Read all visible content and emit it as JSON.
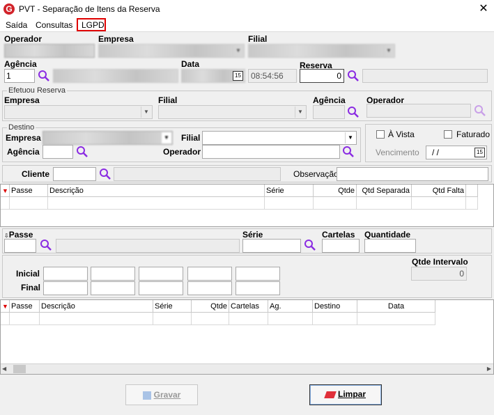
{
  "window": {
    "title": "PVT - Separação de Itens da Reserva",
    "close": "✕",
    "logo": "G"
  },
  "menu": {
    "saida": "Saída",
    "consultas": "Consultas",
    "lgpd": "LGPD"
  },
  "labels": {
    "operador": "Operador",
    "empresa": "Empresa",
    "filial": "Filial",
    "agencia": "Agência",
    "data": "Data",
    "reserva": "Reserva",
    "efetuou_reserva": "Efetuou Reserva",
    "destino": "Destino",
    "a_vista": "À Vista",
    "faturado": "Faturado",
    "vencimento": "Vencimento",
    "cliente": "Cliente",
    "observacao": "Observação",
    "passe": "Passe",
    "serie": "Série",
    "cartelas": "Cartelas",
    "quantidade": "Quantidade",
    "inicial": "Inicial",
    "final": "Final",
    "qtde_intervalo": "Qtde Intervalo"
  },
  "values": {
    "agencia": "1",
    "hora": "08:54:56",
    "vencimento": "/ /",
    "qtde_intervalo": "0",
    "reserva": "0"
  },
  "grid1": {
    "columns": [
      "Passe",
      "Descrição",
      "Série",
      "Qtde",
      "Qtd Separada",
      "Qtd Falta"
    ]
  },
  "grid2": {
    "columns": [
      "Passe",
      "Descrição",
      "Série",
      "Qtde",
      "Cartelas",
      "Ag.",
      "Destino",
      "Data"
    ]
  },
  "buttons": {
    "gravar": "Gravar",
    "limpar": "Limpar"
  },
  "colors": {
    "accent": "#d2232a",
    "search_icon": "#8a2be2"
  }
}
